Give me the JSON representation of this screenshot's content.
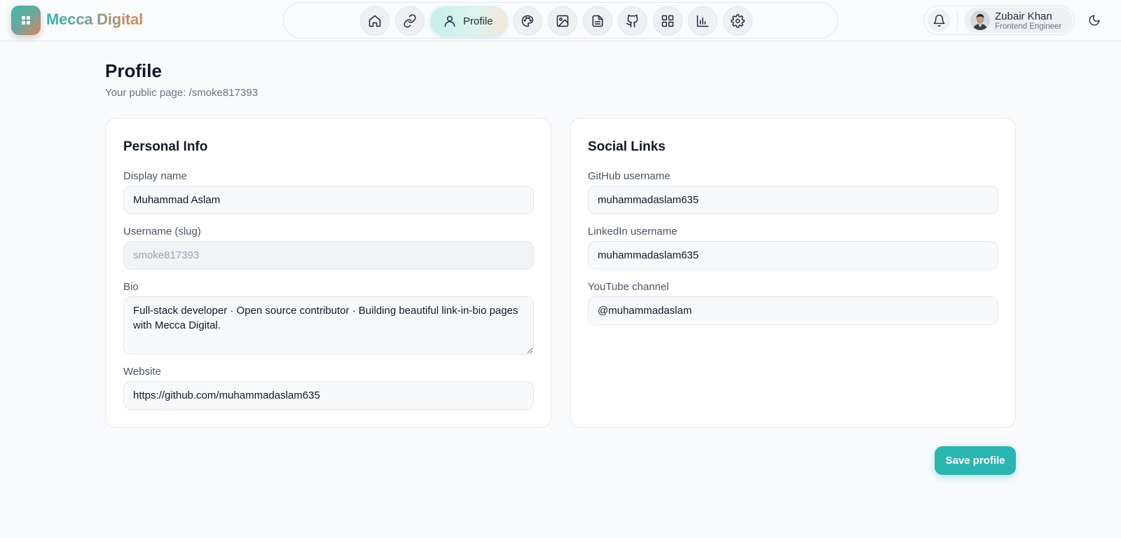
{
  "brand": {
    "name": "Mecca Digital",
    "accent_start": "#2fb5ad",
    "accent_end": "#d9875e"
  },
  "nav": {
    "items": [
      {
        "icon": "home-icon",
        "label": ""
      },
      {
        "icon": "link-icon",
        "label": ""
      },
      {
        "icon": "user-icon",
        "label": "Profile",
        "active": true
      },
      {
        "icon": "palette-icon",
        "label": ""
      },
      {
        "icon": "image-icon",
        "label": ""
      },
      {
        "icon": "document-icon",
        "label": ""
      },
      {
        "icon": "github-icon",
        "label": ""
      },
      {
        "icon": "grid-icon",
        "label": ""
      },
      {
        "icon": "chart-icon",
        "label": ""
      },
      {
        "icon": "gear-icon",
        "label": ""
      }
    ]
  },
  "user": {
    "name": "Zubair Khan",
    "role": "Frontend Engineer"
  },
  "page": {
    "title": "Profile",
    "subtitle": "Your public page: /smoke817393"
  },
  "personal_info": {
    "title": "Personal Info",
    "display_name": {
      "label": "Display name",
      "value": "Muhammad Aslam"
    },
    "username": {
      "label": "Username (slug)",
      "value": "smoke817393"
    },
    "bio": {
      "label": "Bio",
      "value": "Full-stack developer · Open source contributor · Building beautiful link-in-bio pages with Mecca Digital."
    },
    "website": {
      "label": "Website",
      "value": "https://github.com/muhammadaslam635"
    }
  },
  "social_links": {
    "title": "Social Links",
    "github": {
      "label": "GitHub username",
      "value": "muhammadaslam635"
    },
    "linkedin": {
      "label": "LinkedIn username",
      "value": "muhammadaslam635"
    },
    "youtube": {
      "label": "YouTube channel",
      "value": "@muhammadaslam"
    }
  },
  "actions": {
    "save_label": "Save profile",
    "save_color": "#2bb5b1"
  }
}
